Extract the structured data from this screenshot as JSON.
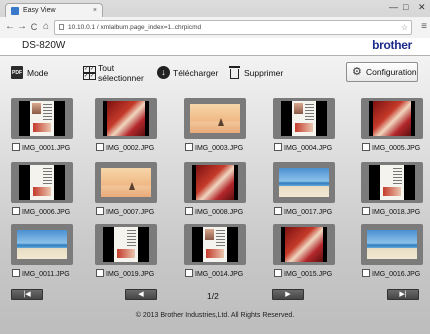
{
  "browser": {
    "tab_title": "Easy View",
    "tab_close": "×",
    "window_controls": [
      "—",
      "□",
      "✕"
    ],
    "back": "←",
    "forward": "→",
    "reload": "C",
    "home": "⌂",
    "url": "10.10.0.1 / xmlalbum.page_index=1..chrpicmd",
    "menu": "≡"
  },
  "header": {
    "model": "DS-820W",
    "brand": "brother"
  },
  "toolbar": {
    "mode_label": "Mode",
    "select_all_line1": "Tout",
    "select_all_line2": "sélectionner",
    "download_label": "Télécharger",
    "delete_label": "Supprimer",
    "config_label": "Configuration"
  },
  "images": [
    {
      "name": "IMG_0001.JPG",
      "kind": "doc-photo"
    },
    {
      "name": "IMG_0002.JPG",
      "kind": "magazine"
    },
    {
      "name": "IMG_0003.JPG",
      "kind": "sunset"
    },
    {
      "name": "IMG_0004.JPG",
      "kind": "doc-photo"
    },
    {
      "name": "IMG_0005.JPG",
      "kind": "magazine"
    },
    {
      "name": "IMG_0006.JPG",
      "kind": "doc"
    },
    {
      "name": "IMG_0007.JPG",
      "kind": "sunset"
    },
    {
      "name": "IMG_0008.JPG",
      "kind": "magazine"
    },
    {
      "name": "IMG_0017.JPG",
      "kind": "beach"
    },
    {
      "name": "IMG_0018.JPG",
      "kind": "doc"
    },
    {
      "name": "IMG_0011.JPG",
      "kind": "beach"
    },
    {
      "name": "IMG_0019.JPG",
      "kind": "doc"
    },
    {
      "name": "IMG_0014.JPG",
      "kind": "doc-photo"
    },
    {
      "name": "IMG_0015.JPG",
      "kind": "magazine"
    },
    {
      "name": "IMG_0016.JPG",
      "kind": "beach"
    }
  ],
  "pagination": {
    "first": "|◀",
    "prev": "◀",
    "page": "1/2",
    "next": "▶",
    "last": "▶|"
  },
  "footer": "© 2013 Brother Industries,Ltd. All Rights Reserved.",
  "colors": {
    "brand": "#1b2b8a",
    "card": "#7b7b7b",
    "button_dark": "#454545"
  }
}
